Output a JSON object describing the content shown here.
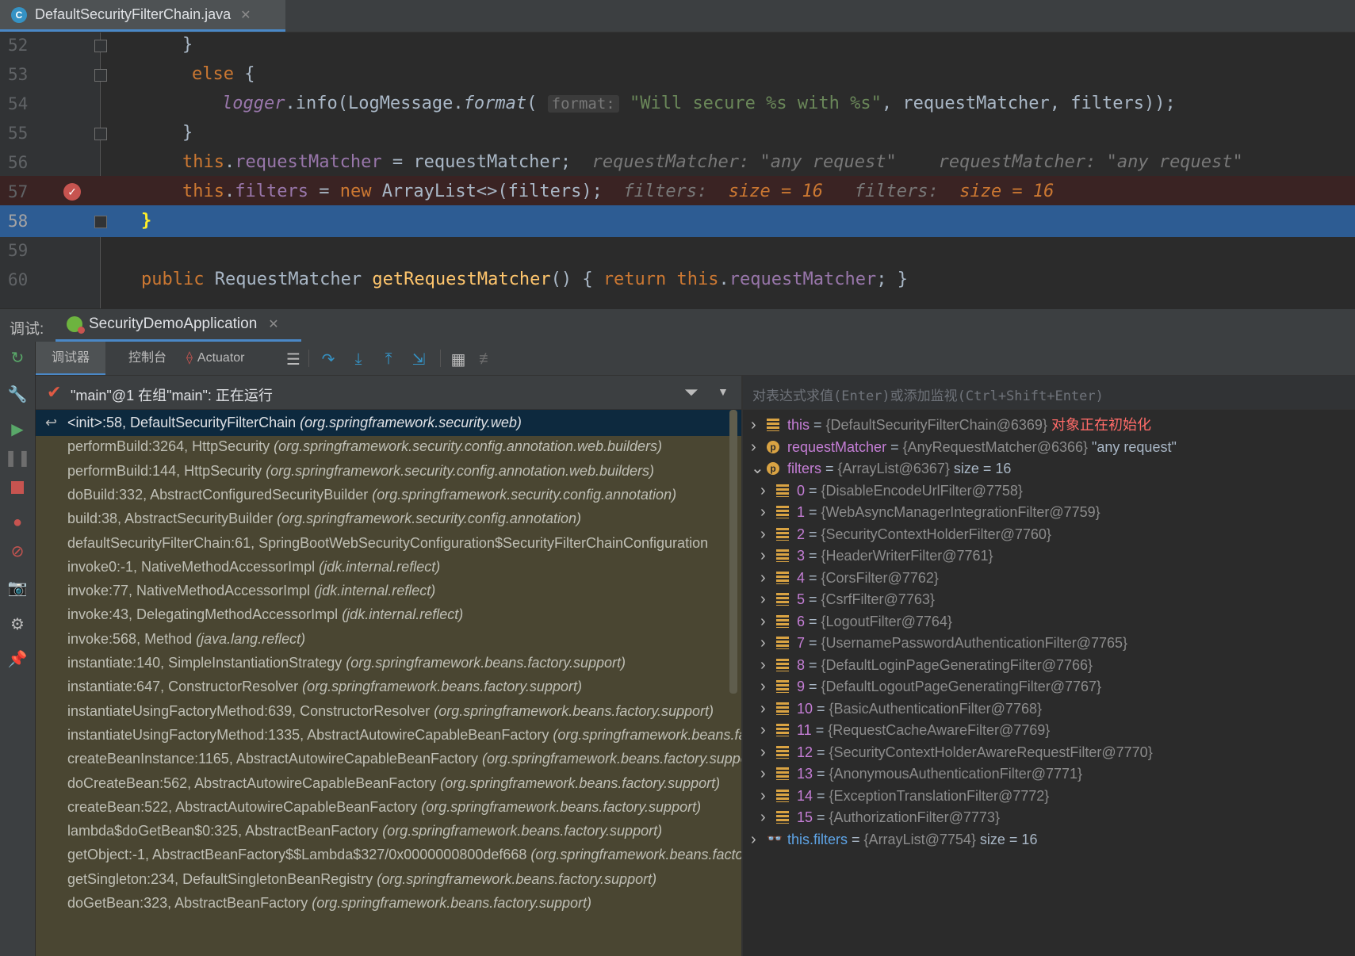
{
  "editor": {
    "file_tab": "DefaultSecurityFilterChain.java",
    "file_icon_letter": "C",
    "lines": [
      {
        "num": "52",
        "segments": [
          {
            "t": "}",
            "c": "plain"
          }
        ],
        "indent": 90
      },
      {
        "num": "53",
        "segments": [
          {
            "t": "else ",
            "c": "kw"
          },
          {
            "t": "{",
            "c": "plain"
          }
        ],
        "indent": 102
      },
      {
        "num": "54",
        "segments": [
          {
            "t": "logger",
            "c": "fldi"
          },
          {
            "t": ".info(LogMessage.",
            "c": "plain"
          },
          {
            "t": "format",
            "c": "ital"
          },
          {
            "t": "( ",
            "c": "plain"
          },
          {
            "t": "format:",
            "c": "hint"
          },
          {
            "t": " ",
            "c": "plain"
          },
          {
            "t": "\"Will secure %s with %s\"",
            "c": "str"
          },
          {
            "t": ", requestMatcher, filters));",
            "c": "plain"
          }
        ],
        "indent": 140
      },
      {
        "num": "55",
        "segments": [
          {
            "t": "}",
            "c": "plain"
          }
        ],
        "indent": 90
      },
      {
        "num": "56",
        "segments": [
          {
            "t": "this",
            "c": "kw"
          },
          {
            "t": ".",
            "c": "plain"
          },
          {
            "t": "requestMatcher",
            "c": "fld"
          },
          {
            "t": " = requestMatcher;",
            "c": "plain"
          },
          {
            "t": "  requestMatcher: \"any request\"    requestMatcher: \"any request\"",
            "c": "inl"
          }
        ],
        "indent": 90
      },
      {
        "num": "57",
        "segments": [
          {
            "t": "this",
            "c": "kw"
          },
          {
            "t": ".",
            "c": "plain"
          },
          {
            "t": "filters",
            "c": "fld"
          },
          {
            "t": " = ",
            "c": "plain"
          },
          {
            "t": "new ",
            "c": "kw"
          },
          {
            "t": "ArrayList<>(filters);",
            "c": "plain"
          },
          {
            "t": "  filters:  ",
            "c": "inl"
          },
          {
            "t": "size = 16",
            "c": "inl-val"
          },
          {
            "t": "   filters:  ",
            "c": "inl"
          },
          {
            "t": "size = 16",
            "c": "inl-val"
          }
        ],
        "indent": 90,
        "breakpoint": true
      },
      {
        "num": "58",
        "segments": [
          {
            "t": "}",
            "c": "brace-cur"
          }
        ],
        "indent": 38,
        "current": true
      },
      {
        "num": "59",
        "segments": [],
        "indent": 0
      },
      {
        "num": "60",
        "segments": [
          {
            "t": "public ",
            "c": "kw"
          },
          {
            "t": "RequestMatcher ",
            "c": "plain"
          },
          {
            "t": "getRequestMatcher",
            "c": "fn"
          },
          {
            "t": "() { ",
            "c": "plain"
          },
          {
            "t": "return ",
            "c": "kw"
          },
          {
            "t": "this",
            "c": "kw"
          },
          {
            "t": ".",
            "c": "plain"
          },
          {
            "t": "requestMatcher",
            "c": "fld"
          },
          {
            "t": "; }",
            "c": "plain"
          }
        ],
        "indent": 38
      }
    ]
  },
  "debug": {
    "label": "调试:",
    "tab": "SecurityDemoApplication",
    "subtabs": {
      "debugger": "调试器",
      "console": "控制台",
      "actuator": "Actuator"
    },
    "thread": "\"main\"@1 在组\"main\": 正在运行",
    "frames": [
      {
        "method": "<init>:58, DefaultSecurityFilterChain ",
        "pkg": "(org.springframework.security.web)",
        "selected": true
      },
      {
        "method": "performBuild:3264, HttpSecurity ",
        "pkg": "(org.springframework.security.config.annotation.web.builders)"
      },
      {
        "method": "performBuild:144, HttpSecurity ",
        "pkg": "(org.springframework.security.config.annotation.web.builders)"
      },
      {
        "method": "doBuild:332, AbstractConfiguredSecurityBuilder ",
        "pkg": "(org.springframework.security.config.annotation)"
      },
      {
        "method": "build:38, AbstractSecurityBuilder ",
        "pkg": "(org.springframework.security.config.annotation)"
      },
      {
        "method": "defaultSecurityFilterChain:61, SpringBootWebSecurityConfiguration$SecurityFilterChainConfiguration ",
        "pkg": ""
      },
      {
        "method": "invoke0:-1, NativeMethodAccessorImpl ",
        "pkg": "(jdk.internal.reflect)"
      },
      {
        "method": "invoke:77, NativeMethodAccessorImpl ",
        "pkg": "(jdk.internal.reflect)"
      },
      {
        "method": "invoke:43, DelegatingMethodAccessorImpl ",
        "pkg": "(jdk.internal.reflect)"
      },
      {
        "method": "invoke:568, Method ",
        "pkg": "(java.lang.reflect)"
      },
      {
        "method": "instantiate:140, SimpleInstantiationStrategy ",
        "pkg": "(org.springframework.beans.factory.support)"
      },
      {
        "method": "instantiate:647, ConstructorResolver ",
        "pkg": "(org.springframework.beans.factory.support)"
      },
      {
        "method": "instantiateUsingFactoryMethod:639, ConstructorResolver ",
        "pkg": "(org.springframework.beans.factory.support)"
      },
      {
        "method": "instantiateUsingFactoryMethod:1335, AbstractAutowireCapableBeanFactory ",
        "pkg": "(org.springframework.beans.factory.support)"
      },
      {
        "method": "createBeanInstance:1165, AbstractAutowireCapableBeanFactory ",
        "pkg": "(org.springframework.beans.factory.support)"
      },
      {
        "method": "doCreateBean:562, AbstractAutowireCapableBeanFactory ",
        "pkg": "(org.springframework.beans.factory.support)"
      },
      {
        "method": "createBean:522, AbstractAutowireCapableBeanFactory ",
        "pkg": "(org.springframework.beans.factory.support)"
      },
      {
        "method": "lambda$doGetBean$0:325, AbstractBeanFactory ",
        "pkg": "(org.springframework.beans.factory.support)"
      },
      {
        "method": "getObject:-1, AbstractBeanFactory$$Lambda$327/0x0000000800def668 ",
        "pkg": "(org.springframework.beans.factory.support)"
      },
      {
        "method": "getSingleton:234, DefaultSingletonBeanRegistry ",
        "pkg": "(org.springframework.beans.factory.support)"
      },
      {
        "method": "doGetBean:323, AbstractBeanFactory ",
        "pkg": "(org.springframework.beans.factory.support)"
      }
    ],
    "watch_placeholder": "对表达式求值(Enter)或添加监视(Ctrl+Shift+Enter)",
    "variables": [
      {
        "icon": "fields",
        "expanded": false,
        "level": 0,
        "name": "this",
        "value": "{DefaultSecurityFilterChain@6369}",
        "note": "对象正在初始化"
      },
      {
        "icon": "p",
        "expanded": false,
        "level": 0,
        "name": "requestMatcher",
        "value": "{AnyRequestMatcher@6366}",
        "extra": "\"any request\""
      },
      {
        "icon": "p",
        "expanded": true,
        "level": 0,
        "name": "filters",
        "value": "{ArrayList@6367}",
        "extra": "size = 16"
      },
      {
        "icon": "fields",
        "expanded": false,
        "level": 1,
        "name": "0",
        "value": "{DisableEncodeUrlFilter@7758}"
      },
      {
        "icon": "fields",
        "expanded": false,
        "level": 1,
        "name": "1",
        "value": "{WebAsyncManagerIntegrationFilter@7759}"
      },
      {
        "icon": "fields",
        "expanded": false,
        "level": 1,
        "name": "2",
        "value": "{SecurityContextHolderFilter@7760}"
      },
      {
        "icon": "fields",
        "expanded": false,
        "level": 1,
        "name": "3",
        "value": "{HeaderWriterFilter@7761}"
      },
      {
        "icon": "fields",
        "expanded": false,
        "level": 1,
        "name": "4",
        "value": "{CorsFilter@7762}"
      },
      {
        "icon": "fields",
        "expanded": false,
        "level": 1,
        "name": "5",
        "value": "{CsrfFilter@7763}"
      },
      {
        "icon": "fields",
        "expanded": false,
        "level": 1,
        "name": "6",
        "value": "{LogoutFilter@7764}"
      },
      {
        "icon": "fields",
        "expanded": false,
        "level": 1,
        "name": "7",
        "value": "{UsernamePasswordAuthenticationFilter@7765}"
      },
      {
        "icon": "fields",
        "expanded": false,
        "level": 1,
        "name": "8",
        "value": "{DefaultLoginPageGeneratingFilter@7766}"
      },
      {
        "icon": "fields",
        "expanded": false,
        "level": 1,
        "name": "9",
        "value": "{DefaultLogoutPageGeneratingFilter@7767}"
      },
      {
        "icon": "fields",
        "expanded": false,
        "level": 1,
        "name": "10",
        "value": "{BasicAuthenticationFilter@7768}"
      },
      {
        "icon": "fields",
        "expanded": false,
        "level": 1,
        "name": "11",
        "value": "{RequestCacheAwareFilter@7769}"
      },
      {
        "icon": "fields",
        "expanded": false,
        "level": 1,
        "name": "12",
        "value": "{SecurityContextHolderAwareRequestFilter@7770}"
      },
      {
        "icon": "fields",
        "expanded": false,
        "level": 1,
        "name": "13",
        "value": "{AnonymousAuthenticationFilter@7771}"
      },
      {
        "icon": "fields",
        "expanded": false,
        "level": 1,
        "name": "14",
        "value": "{ExceptionTranslationFilter@7772}"
      },
      {
        "icon": "fields",
        "expanded": false,
        "level": 1,
        "name": "15",
        "value": "{AuthorizationFilter@7773}"
      },
      {
        "icon": "watch",
        "expanded": false,
        "level": 0,
        "name": "this.filters",
        "value": "{ArrayList@7754}",
        "extra": "size = 16"
      }
    ]
  },
  "colors": {
    "accent": "#4a88c7",
    "current_line": "#2d5c93",
    "breakpoint": "#c75450",
    "frames_bg": "#4a4632"
  }
}
